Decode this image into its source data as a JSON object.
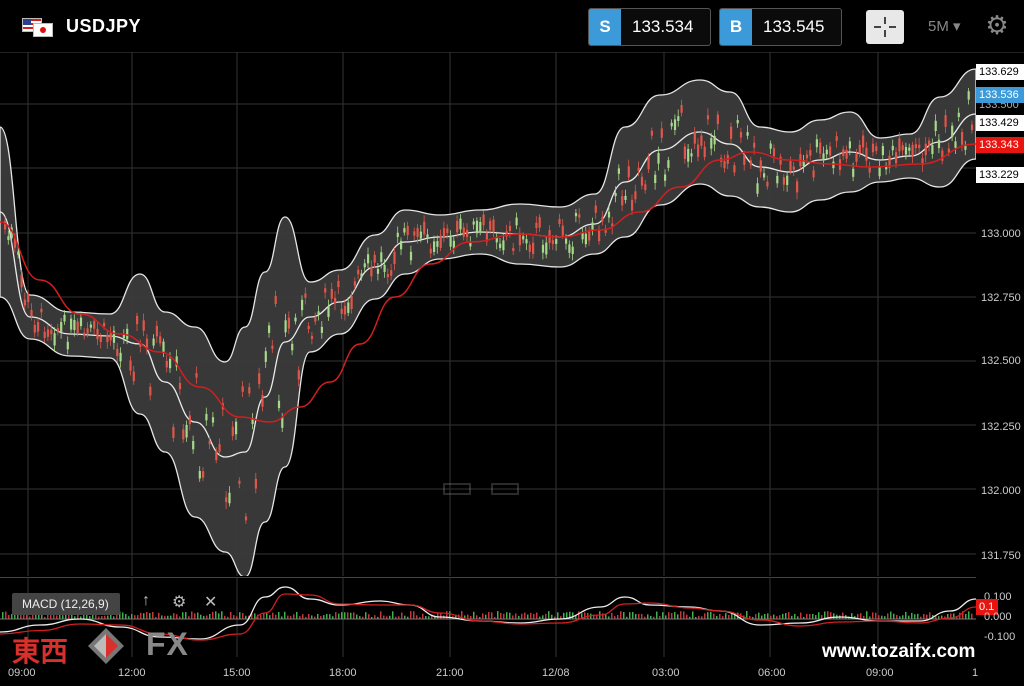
{
  "header": {
    "symbol": "USDJPY",
    "sell": {
      "tag": "S",
      "price": "133.534"
    },
    "buy": {
      "tag": "B",
      "price": "133.545"
    },
    "timeframe": "5M"
  },
  "colors": {
    "accent": "#3c9ad8",
    "red_line": "#d21f1f",
    "band_fill": "#3b3b3b"
  },
  "price_axis": {
    "labels": [
      "133.629",
      "133.429",
      "133.229",
      "133.000",
      "132.750",
      "132.500",
      "132.250",
      "132.000",
      "131.750"
    ],
    "bid_tag": "133.536",
    "ma_tag": "133.343",
    "hidden_tag": "133.500"
  },
  "macd": {
    "label": "MACD (12,26,9)",
    "axis_labels": [
      "0.100",
      "0.000",
      "-0.100"
    ],
    "value_tag": "0.1"
  },
  "time_axis": [
    "09:00",
    "12:00",
    "15:00",
    "18:00",
    "21:00",
    "12/08",
    "03:00",
    "06:00",
    "09:00",
    "1"
  ],
  "watermark": {
    "kanji": "東西",
    "fx": "FX",
    "url": "www.tozaifx.com"
  },
  "icons": [
    "crosshair-icon",
    "gear-icon",
    "arrow-up-icon",
    "close-icon"
  ]
}
